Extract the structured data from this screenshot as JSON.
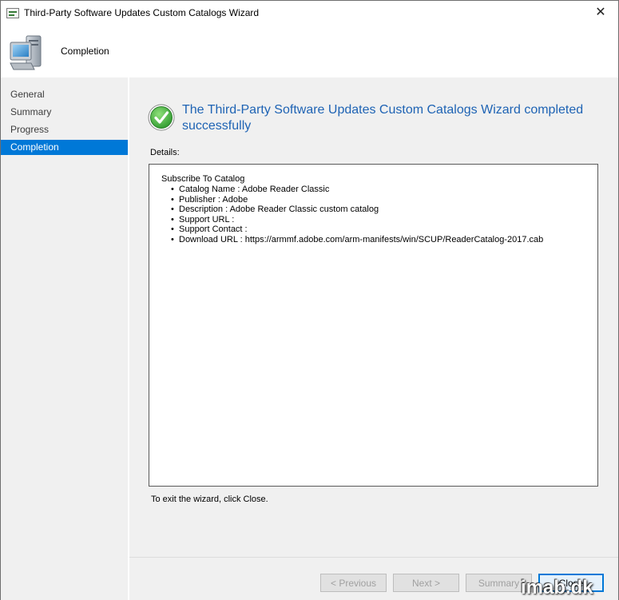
{
  "window": {
    "title": "Third-Party Software Updates Custom Catalogs Wizard",
    "close_glyph": "✕"
  },
  "header": {
    "title": "Completion",
    "icon": "computer-icon"
  },
  "nav": {
    "items": [
      {
        "label": "General",
        "active": false
      },
      {
        "label": "Summary",
        "active": false
      },
      {
        "label": "Progress",
        "active": false
      },
      {
        "label": "Completion",
        "active": true
      }
    ]
  },
  "main": {
    "success_message": "The Third-Party Software Updates Custom Catalogs Wizard completed successfully",
    "details_label": "Details:",
    "details": {
      "heading": "Subscribe To Catalog",
      "items": [
        "Catalog Name : Adobe Reader Classic",
        "Publisher : Adobe",
        "Description : Adobe Reader Classic custom catalog",
        "Support URL :",
        "Support Contact :",
        "Download URL : https://armmf.adobe.com/arm-manifests/win/SCUP/ReaderCatalog-2017.cab"
      ]
    },
    "exit_text": "To exit the wizard, click Close."
  },
  "buttons": {
    "previous": "< Previous",
    "next": "Next >",
    "summary": "Summary",
    "close": "Close"
  },
  "watermark": "imab.dk",
  "colors": {
    "accent": "#0078d7",
    "success_text": "#1e63b4",
    "success_green": "#3ca03c"
  }
}
